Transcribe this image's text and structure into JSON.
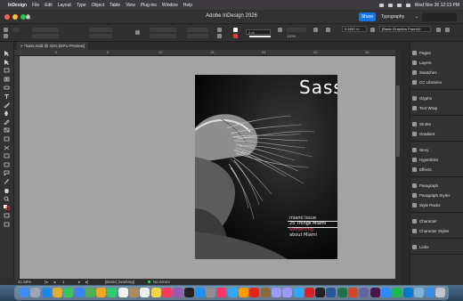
{
  "menubar": {
    "app_name": "InDesign",
    "menus": [
      "File",
      "Edit",
      "Layout",
      "Type",
      "Object",
      "Table",
      "View",
      "Plug-ins",
      "Window",
      "Help"
    ],
    "datetime": "Wed Nov 26 12:13 PM"
  },
  "titlebar": {
    "title": "Adobe InDesign 2026",
    "share_label": "Share",
    "workspace": "Typography",
    "search_placeholder": ""
  },
  "control_panel": {
    "stroke_weight": "0 pt",
    "zoom_percent": "100%",
    "value_field": "0.1667 in",
    "style_field": "[Basic Graphics Frame]+"
  },
  "document": {
    "tab_label": "*Sass.indd @ 41% [GPU Preview]",
    "ruler_numbers": [
      "0",
      "6",
      "12",
      "18",
      "24",
      "30",
      "36"
    ],
    "cover_title": "Sass",
    "cover_lines": [
      "miami issue",
      "25 Things Miami",
      "Something",
      "about Miami"
    ]
  },
  "statusbar": {
    "zoom": "41.66%",
    "page": "1",
    "profile": "[Basic] (working)",
    "errors": "No errors"
  },
  "panels": {
    "items": [
      {
        "label": "Pages",
        "icon": "pages-icon"
      },
      {
        "label": "Layers",
        "icon": "layers-icon"
      },
      {
        "label": "Swatches",
        "icon": "swatches-icon"
      },
      {
        "label": "CC Libraries",
        "icon": "cc-libraries-icon"
      },
      {
        "label": "Glyphs",
        "icon": "glyphs-icon"
      },
      {
        "label": "Text Wrap",
        "icon": "text-wrap-icon"
      },
      {
        "label": "Stroke",
        "icon": "stroke-icon"
      },
      {
        "label": "Gradient",
        "icon": "gradient-icon"
      },
      {
        "label": "Story",
        "icon": "story-icon"
      },
      {
        "label": "Hyperlinks",
        "icon": "hyperlinks-icon"
      },
      {
        "label": "Effects",
        "icon": "effects-icon"
      },
      {
        "label": "Paragraph",
        "icon": "paragraph-icon"
      },
      {
        "label": "Paragraph Styles",
        "icon": "paragraph-styles-icon"
      },
      {
        "label": "Style Packs",
        "icon": "style-packs-icon"
      },
      {
        "label": "Character",
        "icon": "character-icon"
      },
      {
        "label": "Character Styles",
        "icon": "character-styles-icon"
      },
      {
        "label": "Links",
        "icon": "links-icon"
      }
    ]
  },
  "colors": {
    "accent": "#1473e6",
    "pink_text": "#ff3d6e",
    "pasteboard": "#a3a3a3"
  }
}
